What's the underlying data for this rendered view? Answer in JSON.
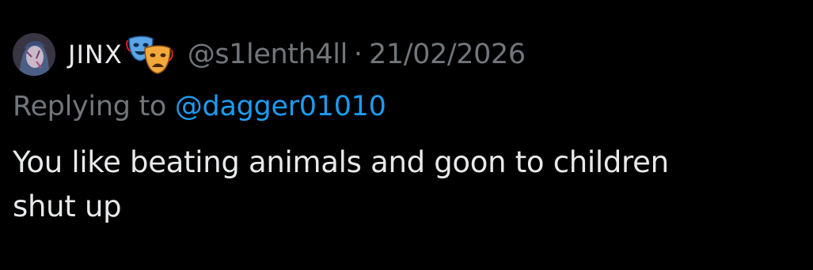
{
  "tweet": {
    "author": {
      "display_name": "JINX",
      "avatar_icon": "avatar-image",
      "badge_icon": "performing-arts-emoji-icon",
      "handle": "@s1lenth4ll"
    },
    "separator": "·",
    "date": "21/02/2026",
    "reply": {
      "prefix": "Replying to",
      "mention": "@dagger01010"
    },
    "text_line_1": "You like beating animals and goon to children",
    "text_line_2": "shut up"
  },
  "colors": {
    "background": "#000000",
    "text_primary": "#e7e9ea",
    "text_secondary": "#71767b",
    "link": "#1d9bf0"
  }
}
